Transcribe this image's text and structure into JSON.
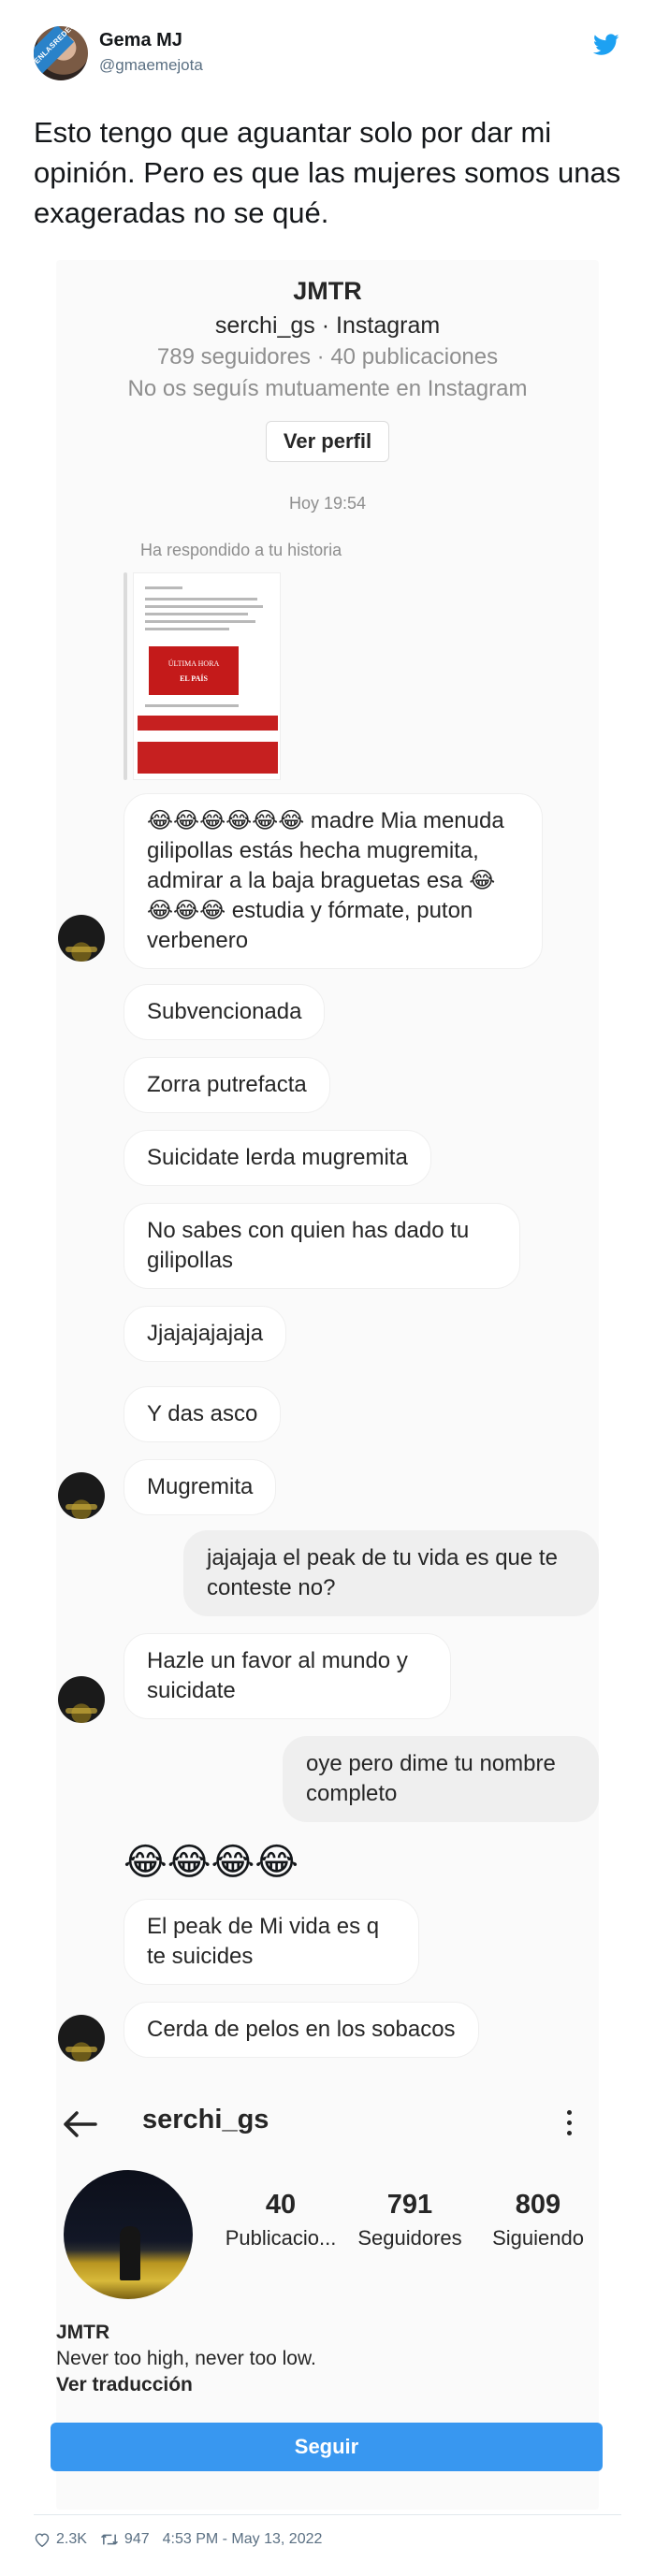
{
  "tweet": {
    "author_name": "Gema MJ",
    "author_handle": "@gmaemejota",
    "badge_text": "VISTOENLASREDES.COM",
    "text": "Esto tengo que aguantar solo por dar mi opinión. Pero es que las mujeres somos unas exageradas no se qué.",
    "likes": "2.3K",
    "retweets": "947",
    "time": "4:53 PM - May 13, 2022"
  },
  "dm": {
    "profile_name": "JMTR",
    "profile_sub": "serchi_gs · Instagram",
    "stats": "789 seguidores · 40 publicaciones",
    "mutual": "No os seguís mutuamente en Instagram",
    "view_profile_label": "Ver perfil",
    "timestamp": "Hoy 19:54",
    "replied_label": "Ha respondido a tu historia",
    "story_headline": "ÚLTIMA HORA",
    "story_source": "EL PAÍS",
    "messages": [
      {
        "text": "😂😂😂😂😂😂 madre Mia menuda gilipollas estás hecha mugremita, admirar a la baja braguetas esa 😂😂😂😂 estudia y fórmate, puton verbenero"
      },
      {
        "text": "Subvencionada"
      },
      {
        "text": "Zorra putrefacta"
      },
      {
        "text": "Suicidate lerda mugremita"
      },
      {
        "text": "No sabes con quien has dado tu gilipollas"
      },
      {
        "text": "Jjajajajajaja"
      },
      {
        "text": "Y das asco"
      },
      {
        "text": "Mugremita"
      },
      {
        "text": "jajajaja el peak de tu vida es que te conteste no?"
      },
      {
        "text": "Hazle un favor al mundo y suicidate"
      },
      {
        "text": "oye pero dime tu nombre completo"
      },
      {
        "text": "😂😂😂😂"
      },
      {
        "text": "El peak de Mi vida es q te suicides"
      },
      {
        "text": "Cerda de pelos en los sobacos"
      }
    ]
  },
  "profile": {
    "username": "serchi_gs",
    "posts_num": "40",
    "posts_label": "Publicacio...",
    "followers_num": "791",
    "followers_label": "Seguidores",
    "following_num": "809",
    "following_label": "Siguiendo",
    "name": "JMTR",
    "bio": "Never too high, never too low.",
    "translate_label": "Ver traducción",
    "follow_label": "Seguir"
  },
  "colors": {
    "twitter_blue": "#1da1f2",
    "instagram_blue": "#3897f0",
    "muted_gray": "#8e8e8e"
  }
}
